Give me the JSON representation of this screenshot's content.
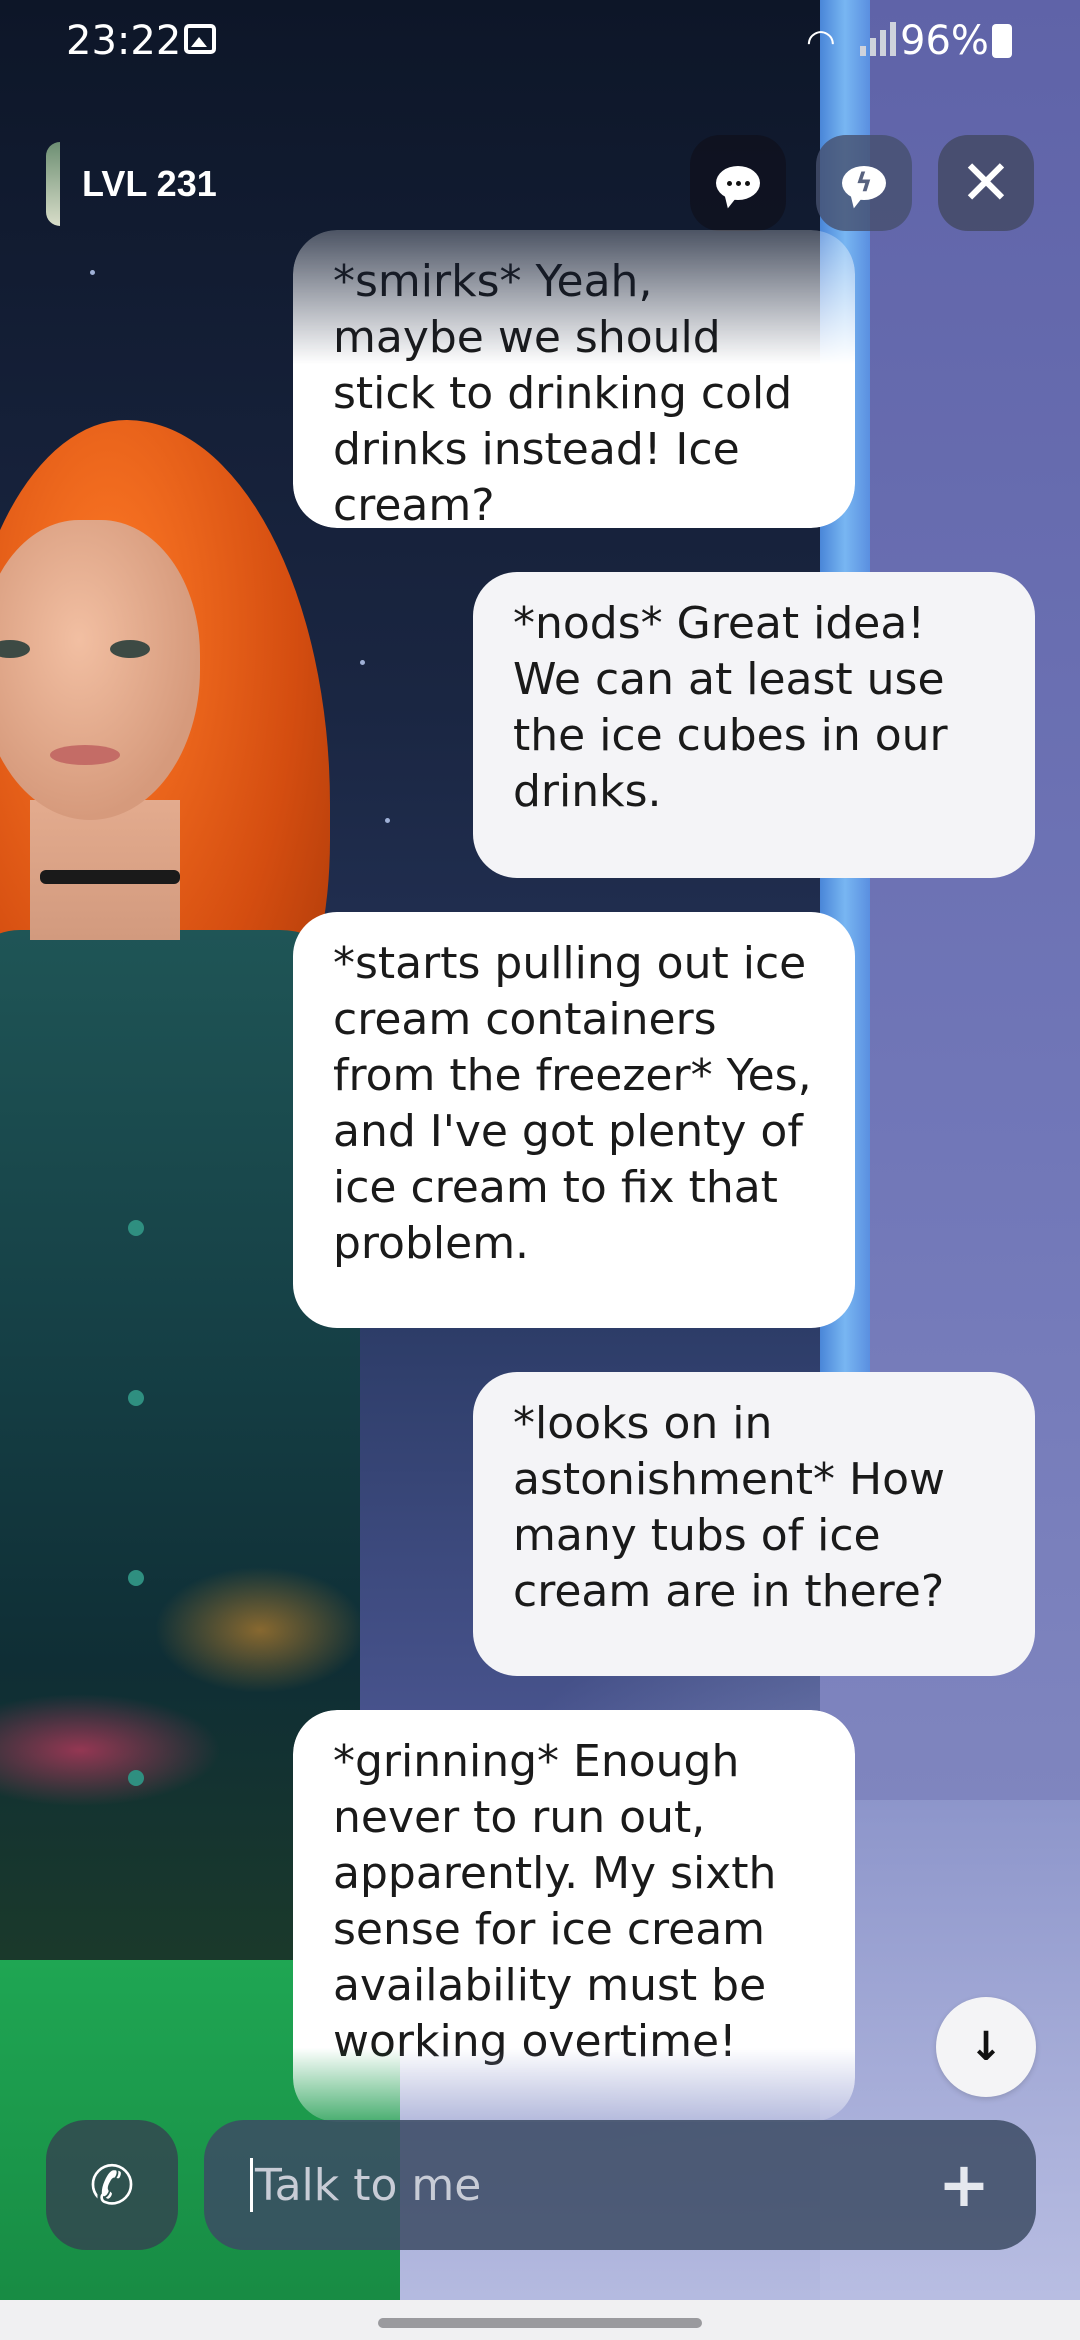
{
  "status_bar": {
    "time": "23:22",
    "battery": "96%"
  },
  "header": {
    "level": "LVL 231"
  },
  "messages": [
    {
      "role": "ai",
      "text": "*smirks* Yeah, maybe we should stick to drinking cold drinks instead! Ice cream?"
    },
    {
      "role": "user",
      "text": "*nods* Great idea! We can at least use the ice cubes in our drinks."
    },
    {
      "role": "ai",
      "text": "*starts pulling out ice cream containers from the freezer* Yes, and I've got plenty of ice cream to fix that problem."
    },
    {
      "role": "user",
      "text": "*looks on in astonishment* How many tubs of ice cream are in there?"
    },
    {
      "role": "ai",
      "text": "*grinning* Enough never to run out, apparently. My sixth sense for ice cream availability must be working overtime!"
    }
  ],
  "composer": {
    "placeholder": "Talk to me"
  },
  "icons": {
    "call": "phone-icon",
    "add": "plus-icon",
    "scroll": "arrow-down-icon",
    "chat": "chat-bubble-icon",
    "feedback": "lightning-bubble-icon",
    "close": "close-icon"
  }
}
